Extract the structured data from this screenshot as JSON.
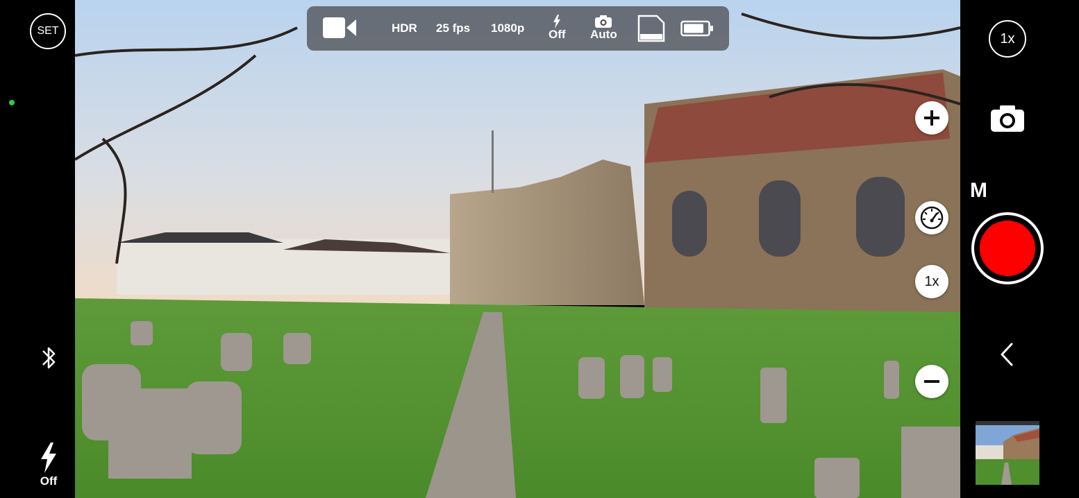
{
  "top_bar": {
    "hdr": "HDR",
    "fps": "25 fps",
    "resolution": "1080p",
    "flash_status": "Off",
    "capture_mode": "Auto",
    "icons": [
      "video-camera-icon",
      "flash-icon",
      "camera-icon",
      "sd-card-icon",
      "battery-icon"
    ]
  },
  "left_bar": {
    "settings_label": "SET",
    "flash_label": "Off",
    "icons": [
      "bluetooth-icon",
      "flash-icon"
    ]
  },
  "overlay": {
    "zoom_label": "1x",
    "icons": [
      "zoom-in-icon",
      "speedometer-icon",
      "zoom-out-icon"
    ]
  },
  "right_bar": {
    "lens_label": "1x",
    "mode_label": "M",
    "icons": [
      "camera-icon",
      "record-icon",
      "chevron-left-icon"
    ]
  },
  "colors": {
    "record": "#ff0000",
    "status_dot": "#2ecc40",
    "top_bar_bg": "#46464a"
  }
}
